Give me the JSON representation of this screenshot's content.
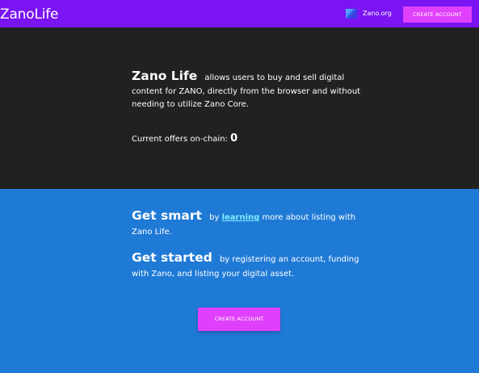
{
  "header": {
    "brand": "ZanoLife",
    "zano_link": "Zano.org",
    "zano_icon": "zano-logo-icon",
    "create_account_label": "CREATE ACCOUNT",
    "bg_color": "#7a14f2",
    "button_color": "#e040fb"
  },
  "hero": {
    "title": "Zano Life",
    "description": "allows users to buy and sell digital content for ZANO, directly from the browser and without needing to utilize Zano Core.",
    "offers_label": "Current offers on-chain:",
    "offers_count": "0",
    "bg_color": "#212121"
  },
  "info": {
    "smart_heading": "Get smart",
    "smart_before": "by",
    "smart_link": "learning",
    "smart_after": "more about listing with Zano Life.",
    "started_heading": "Get started",
    "started_text": "by registering an account, funding with Zano, and listing your digital asset.",
    "create_account_label": "CREATE ACCOUNT",
    "bg_color": "#1f7ad6",
    "link_color": "#7ef0ff"
  }
}
